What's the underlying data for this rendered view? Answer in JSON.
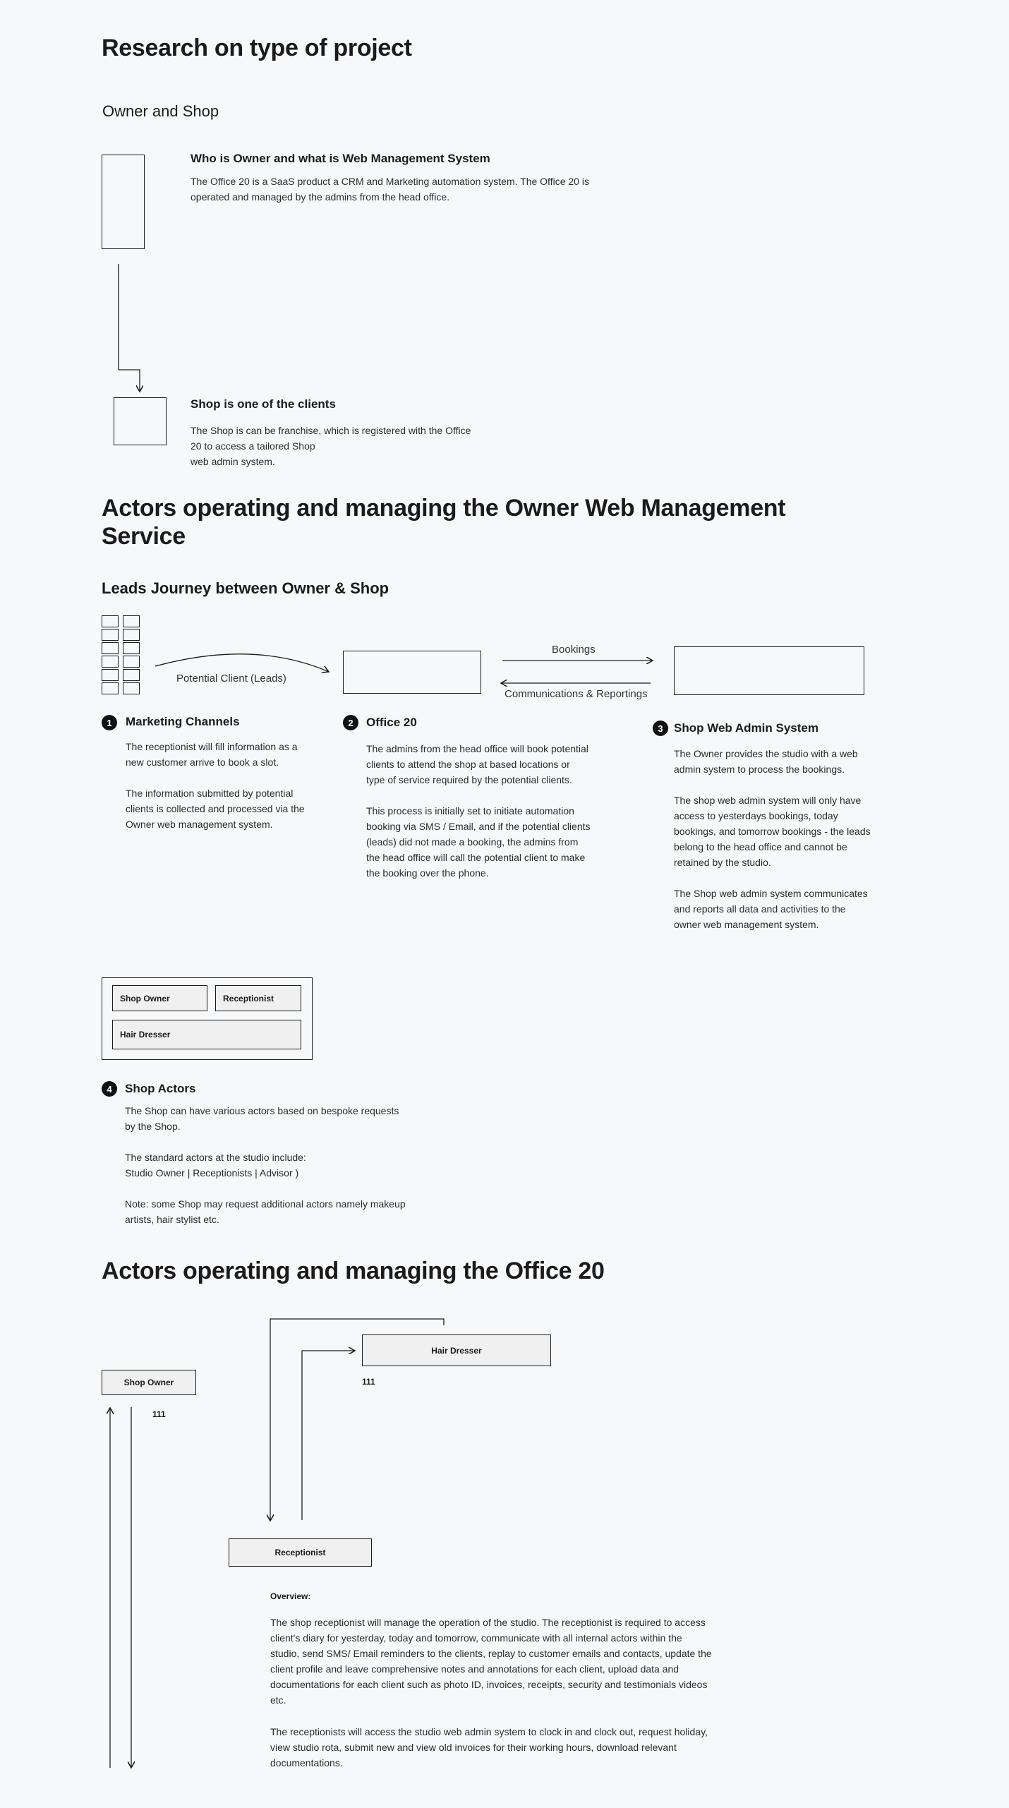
{
  "section1": {
    "title": "Research on type of project",
    "subtitle": "Owner and Shop",
    "owner_heading": "Who is Owner and what is Web Management System",
    "owner_text": "The Office 20 is a SaaS product a CRM and Marketing automation system. The Office 20 is\noperated and managed by the admins from the head office.",
    "shop_heading": "Shop is one of the clients",
    "shop_text": "The Shop is can be franchise, which is registered with the Office\n20 to access a tailored Shop\nweb admin system."
  },
  "section2": {
    "title": "Actors operating and managing the Owner Web Management\nService",
    "subtitle": "Leads Journey between Owner & Shop",
    "arrow_leads_label": "Potential Client (Leads)",
    "arrow_bookings_label": "Bookings",
    "arrow_comms_label": "Communications & Reportings",
    "steps": [
      {
        "num": "1",
        "title": "Marketing Channels",
        "text": "The receptionist will fill information as a\nnew customer arrive to book a slot.\n\nThe information submitted by potential\nclients is collected and processed via the\nOwner web management system."
      },
      {
        "num": "2",
        "title": "Office 20",
        "text": "The admins from the head office will book potential\nclients to attend the shop at  based locations or\ntype of service required by the potential clients.\n\nThis process is initially set to initiate automation\nbooking via SMS / Email, and if the potential clients\n(leads) did not made a booking, the admins from\nthe head office will call the potential client to make\nthe booking over the phone."
      },
      {
        "num": "3",
        "title": "Shop Web Admin System",
        "text": "The Owner provides the studio with a web\nadmin system to process the bookings.\n\nThe shop web admin system will only have\naccess to yesterdays bookings, today\nbookings, and tomorrow bookings - the leads\nbelong to the head office and cannot be\nretained by the studio.\n\nThe Shop web admin system communicates\nand reports all data and activities to the\nowner web management system."
      }
    ],
    "actors_chips": {
      "owner": "Shop Owner",
      "receptionist": "Receptionist",
      "hairdresser": "Hair Dresser"
    },
    "step4": {
      "num": "4",
      "title": "Shop Actors",
      "text": "The Shop can have various actors based on bespoke requests\nby the Shop.\n\nThe standard actors at the studio include:\nStudio Owner | Receptionists | Advisor )\n\nNote: some Shop may request additional actors namely makeup\nartists, hair stylist etc."
    }
  },
  "section3": {
    "title": "Actors operating and managing the Office 20",
    "hairdresser": "Hair Dresser",
    "hairdresser_count": "111",
    "owner": "Shop Owner",
    "owner_count": "111",
    "receptionist": "Receptionist",
    "overview_label": "Overview:",
    "overview_p1": "The shop receptionist will manage the operation of the studio. The receptionist is required to access\nclient's diary for yesterday, today and tomorrow, communicate with all internal actors within the\nstudio, send SMS/ Email reminders to the clients, replay to customer emails and contacts, update the\nclient profile and leave comprehensive notes and annotations for each client,  upload data and\ndocumentations for each client such as photo ID, invoices, receipts, security and testimonials videos\netc.",
    "overview_p2": "The receptionists will access the studio web admin system to clock in and clock out, request holiday,\nview studio rota, submit new and view old invoices for their working hours, download relevant\ndocumentations."
  }
}
